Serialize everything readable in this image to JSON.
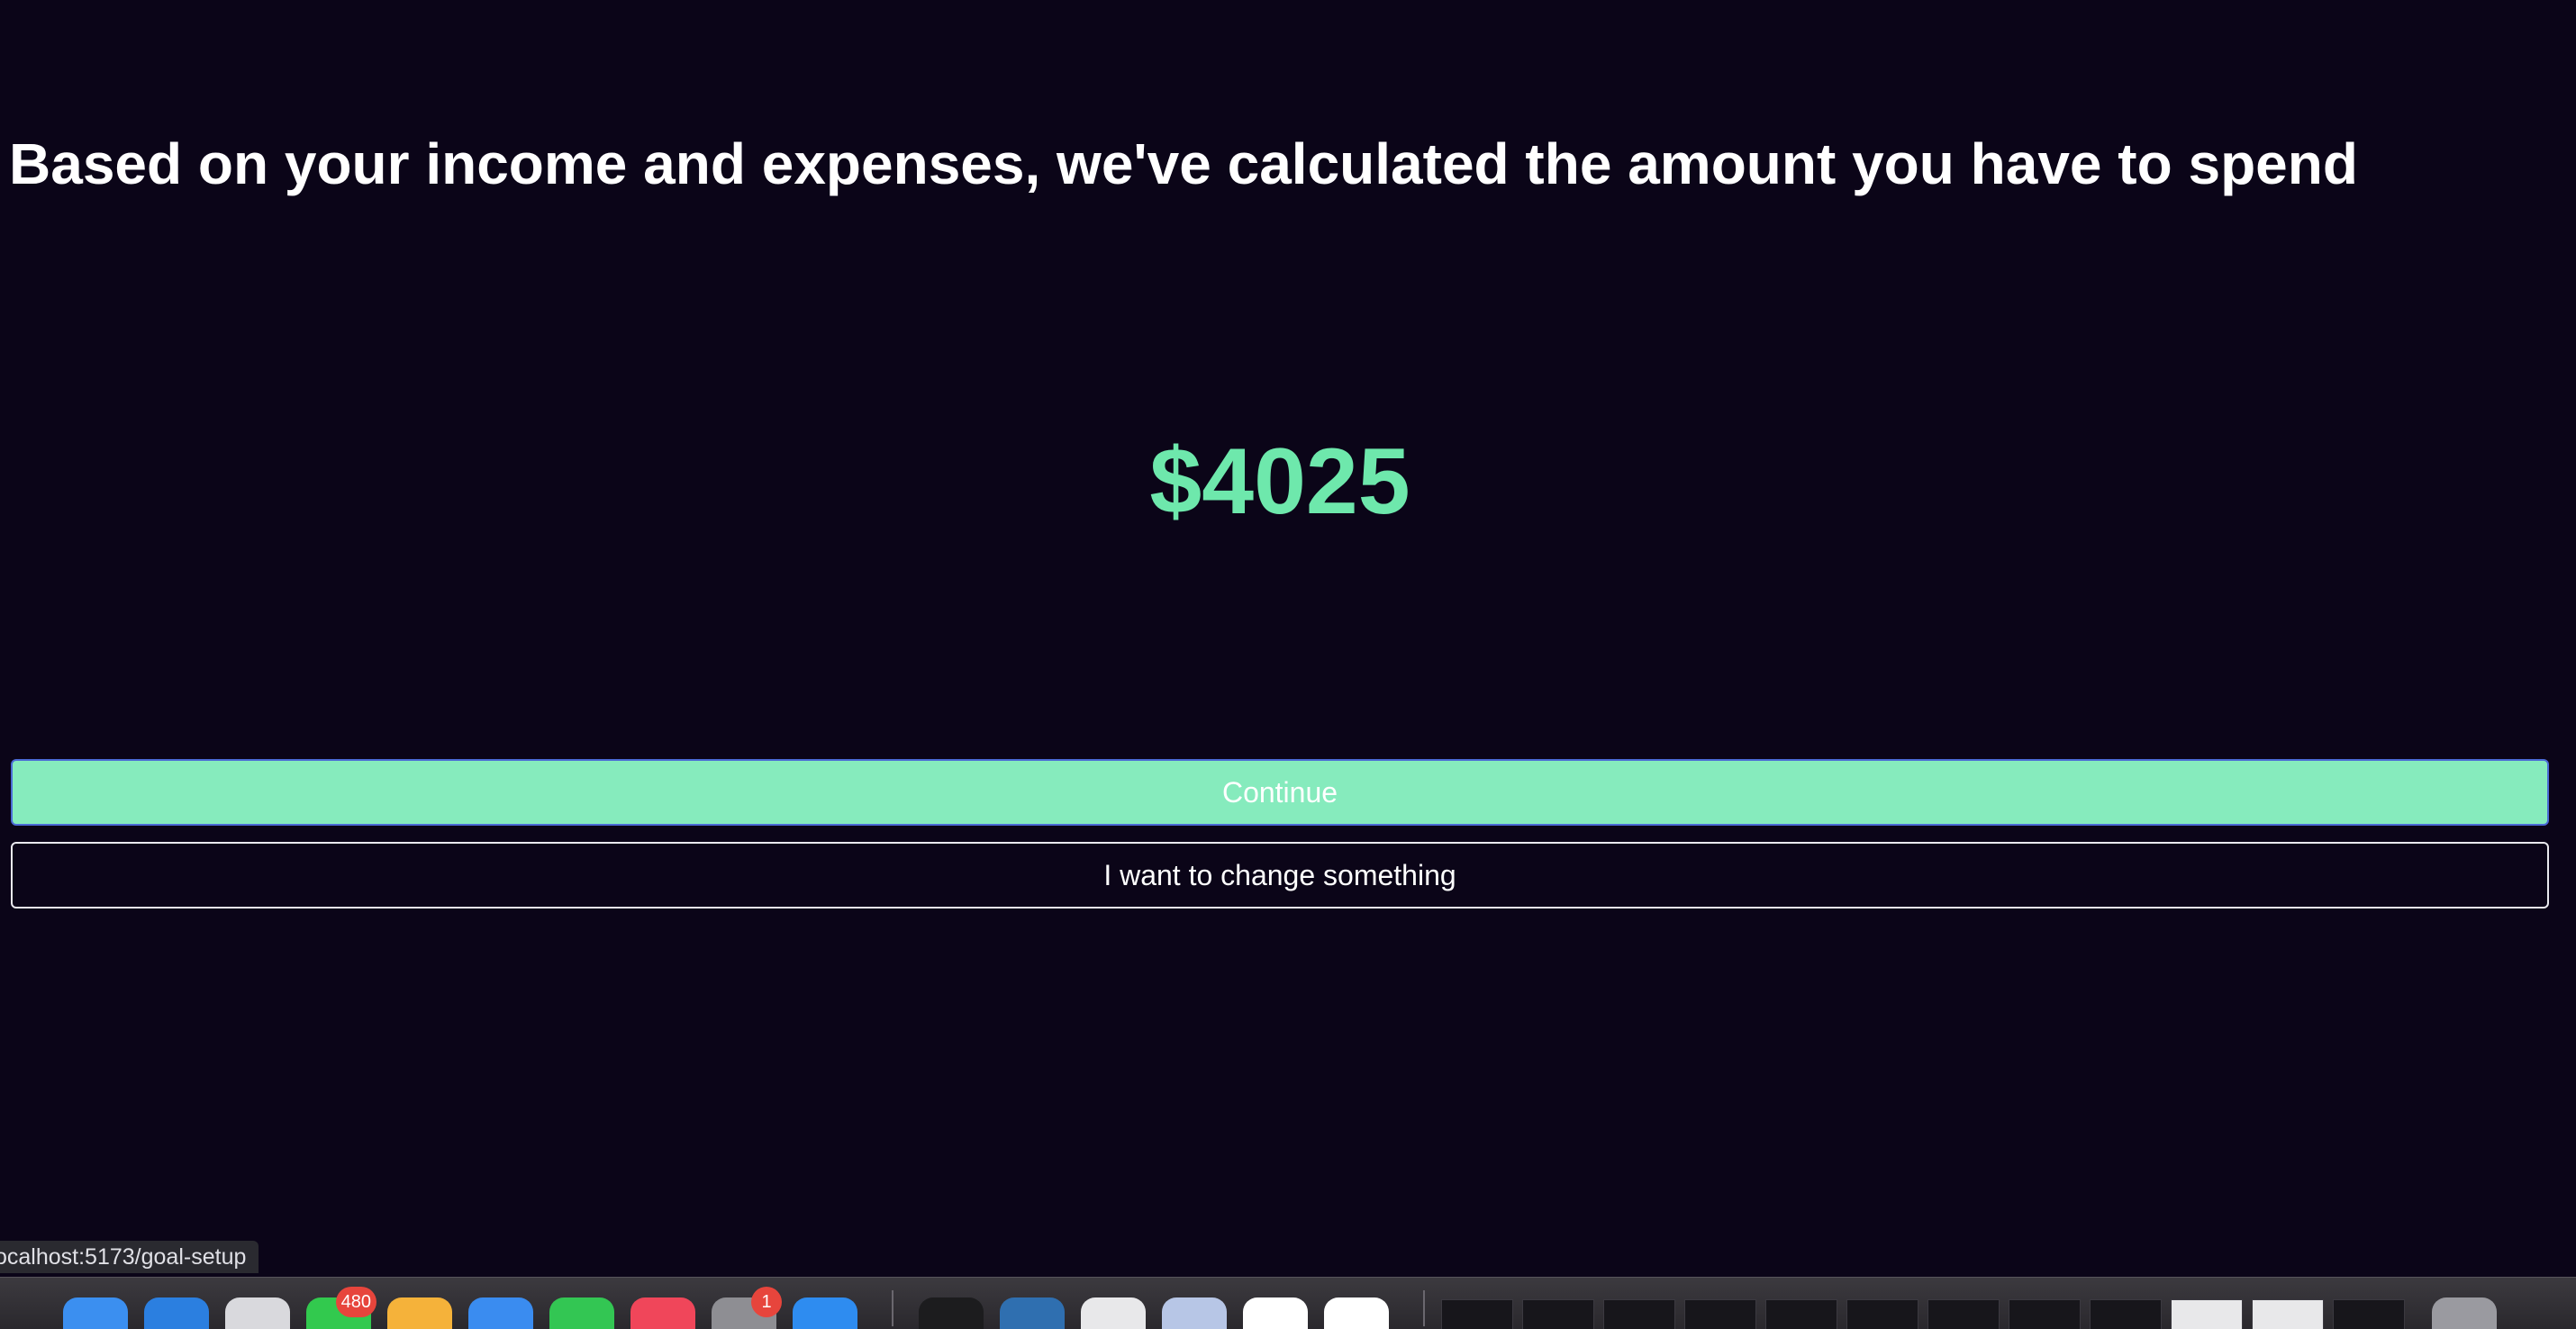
{
  "main": {
    "headline": "Based on your income and expenses, we've calculated the amount you have to spend",
    "amount": "$4025",
    "continue_label": "Continue",
    "change_label": "I want to change something"
  },
  "status_bar": {
    "url": "ocalhost:5173/goal-setup"
  },
  "dock": {
    "apps": [
      {
        "name": "finder-icon",
        "color": "#3b8ff0"
      },
      {
        "name": "safari-icon",
        "color": "#2b7fe0"
      },
      {
        "name": "launchpad-icon",
        "color": "#d9d9dd"
      },
      {
        "name": "messages-icon",
        "color": "#32c94e",
        "badge": "480"
      },
      {
        "name": "photos-icon",
        "color": "#f5b23a"
      },
      {
        "name": "mail-icon",
        "color": "#3a8cf0"
      },
      {
        "name": "facetime-icon",
        "color": "#33c653"
      },
      {
        "name": "music-icon",
        "color": "#f0465a"
      },
      {
        "name": "system-settings-icon",
        "color": "#8e8e93",
        "badge": "1"
      },
      {
        "name": "app-store-icon",
        "color": "#2e8cf0"
      },
      {
        "name": "terminal-icon",
        "color": "#1c1c1e"
      },
      {
        "name": "mysql-workbench-icon",
        "color": "#2f6fb0"
      },
      {
        "name": "chrome-icon",
        "color": "#e8e8ea"
      },
      {
        "name": "preview-icon",
        "color": "#b7c6e6"
      },
      {
        "name": "vscode-icon",
        "color": "#ffffff"
      },
      {
        "name": "word-icon",
        "color": "#ffffff"
      }
    ]
  }
}
